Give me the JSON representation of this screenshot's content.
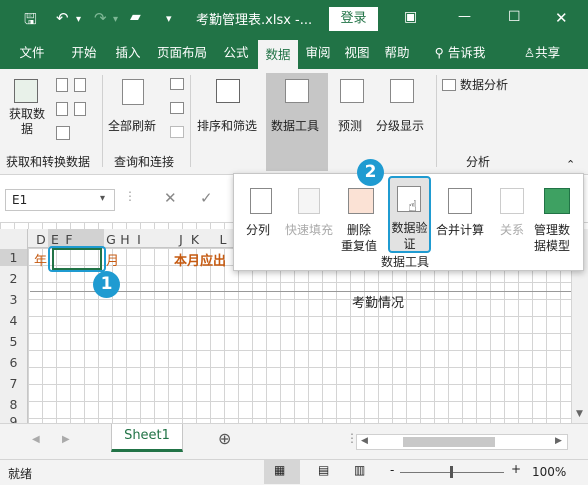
{
  "colors": {
    "accent": "#217346",
    "highlight": "#1f9bd1",
    "orange_text": "#c55a11"
  },
  "titlebar": {
    "save_icon": "save-icon",
    "undo_icon": "undo-icon",
    "redo_icon": "redo-icon",
    "open_icon": "open-folder-icon",
    "customize_icon": "customize-quick-access-icon",
    "title": "考勤管理表.xlsx -...",
    "login": "登录",
    "ribbon_display_icon": "ribbon-display-options-icon",
    "min_icon": "minimize-icon",
    "max_icon": "maximize-icon",
    "close_icon": "close-icon"
  },
  "tabs": [
    "文件",
    "开始",
    "插入",
    "页面布局",
    "公式",
    "数据",
    "审阅",
    "视图",
    "帮助"
  ],
  "tell_me": "告诉我",
  "share": "共享",
  "ribbon": {
    "get_data": "获取数\n据",
    "group1": "获取和转换数据",
    "refresh_all": "全部刷新",
    "group2": "查询和连接",
    "sort_filter": "排序和筛选",
    "data_tools": "数据工具",
    "forecast": "预测",
    "outline": "分级显示",
    "data_analysis": "数据分析",
    "group_analysis": "分析"
  },
  "formula": {
    "name_box": "E1",
    "cancel_icon": "cancel-icon",
    "enter_icon": "enter-icon"
  },
  "popup": {
    "split": "分列",
    "flash_fill": "快速填充",
    "remove_dup": "删除\n重复值",
    "validation": "数据验\n证",
    "consolidate": "合并计算",
    "relationships": "关系",
    "manage_model": "管理数\n据模型",
    "group_label": "数据工具",
    "badge2": "2"
  },
  "grid": {
    "columns": [
      "D",
      "E",
      "F",
      "G",
      "H",
      "I",
      "J",
      "K",
      "L"
    ],
    "rows": [
      "1",
      "2",
      "3",
      "4",
      "5",
      "6",
      "7",
      "8",
      "9"
    ],
    "r1_year": "年",
    "r1_month": "月",
    "r1_due": "本月应出",
    "title_cell": "考勤情况",
    "badge1": "1"
  },
  "sheet": {
    "tab": "Sheet1",
    "add_icon": "add-sheet-icon"
  },
  "status": {
    "ready": "就绪",
    "zoom": "100%",
    "minus": "-",
    "plus": "+"
  }
}
